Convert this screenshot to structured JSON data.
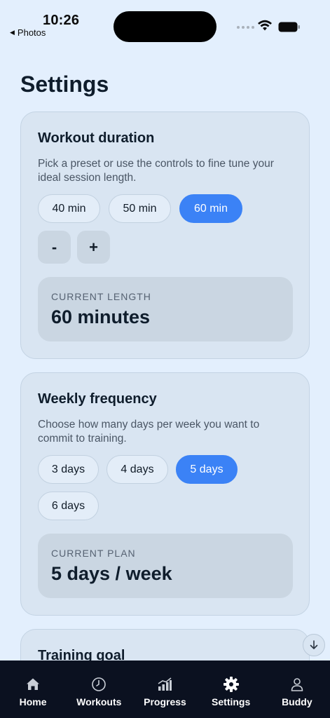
{
  "status_bar": {
    "time": "10:26",
    "back_app": "Photos"
  },
  "page": {
    "title": "Settings"
  },
  "duration_card": {
    "title": "Workout duration",
    "description": "Pick a preset or use the controls to fine tune your ideal session length.",
    "presets": [
      {
        "label": "40 min",
        "selected": false
      },
      {
        "label": "50 min",
        "selected": false
      },
      {
        "label": "60 min",
        "selected": true
      }
    ],
    "decrement_label": "-",
    "increment_label": "+",
    "summary_label": "CURRENT LENGTH",
    "summary_value": "60 minutes"
  },
  "frequency_card": {
    "title": "Weekly frequency",
    "description": "Choose how many days per week you want to commit to training.",
    "options": [
      {
        "label": "3 days",
        "selected": false
      },
      {
        "label": "4 days",
        "selected": false
      },
      {
        "label": "5 days",
        "selected": true
      },
      {
        "label": "6 days",
        "selected": false
      }
    ],
    "summary_label": "CURRENT PLAN",
    "summary_value": "5 days / week"
  },
  "goal_card": {
    "title": "Training goal"
  },
  "scroll_button_icon": "arrow-down-icon",
  "tabbar": {
    "items": [
      {
        "label": "Home",
        "icon": "home-icon",
        "active": false
      },
      {
        "label": "Workouts",
        "icon": "clock-icon",
        "active": false
      },
      {
        "label": "Progress",
        "icon": "chart-icon",
        "active": false
      },
      {
        "label": "Settings",
        "icon": "gear-icon",
        "active": true
      },
      {
        "label": "Buddy",
        "icon": "person-icon",
        "active": false
      }
    ]
  },
  "colors": {
    "background": "#e3effd",
    "card": "#d9e5f2",
    "accent": "#3b82f6",
    "tabbar": "#0b1120"
  }
}
